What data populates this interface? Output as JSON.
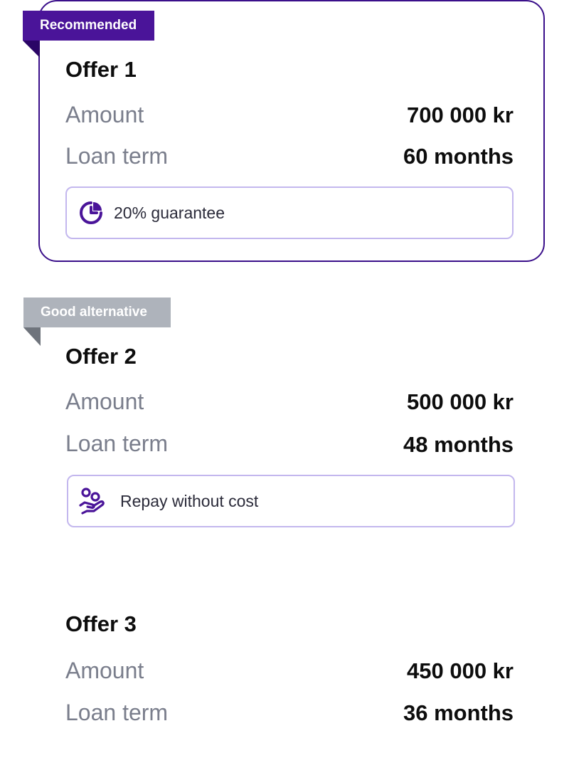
{
  "offers": [
    {
      "badge": "Recommended",
      "title": "Offer 1",
      "amount_label": "Amount",
      "amount_value": "700 000 kr",
      "term_label": "Loan term",
      "term_value": "60 months",
      "feature_text": "20% guarantee",
      "feature_icon": "pie-chart-icon"
    },
    {
      "badge": "Good alternative",
      "title": "Offer 2",
      "amount_label": "Amount",
      "amount_value": "500 000 kr",
      "term_label": "Loan term",
      "term_value": "48 months",
      "feature_text": "Repay without cost",
      "feature_icon": "hand-coins-icon"
    },
    {
      "title": "Offer 3",
      "amount_label": "Amount",
      "amount_value": "450 000 kr",
      "term_label": "Loan term",
      "term_value": "36 months"
    }
  ],
  "colors": {
    "accent_purple": "#4a1499",
    "card_border": "#3a0f8a",
    "feature_border": "#c3b7ee",
    "alt_badge": "#aeb3bb",
    "label_gray": "#7a7e8c"
  }
}
